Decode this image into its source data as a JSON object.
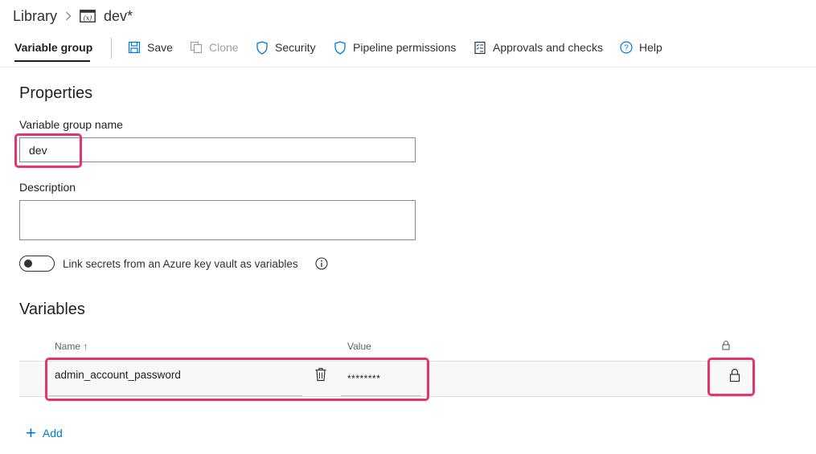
{
  "breadcrumb": {
    "root": "Library",
    "current": "dev*"
  },
  "toolbar": {
    "tab": "Variable group",
    "save": "Save",
    "clone": "Clone",
    "security": "Security",
    "pipeline_permissions": "Pipeline permissions",
    "approvals": "Approvals and checks",
    "help": "Help"
  },
  "properties": {
    "title": "Properties",
    "name_label": "Variable group name",
    "name_value": "dev",
    "description_label": "Description",
    "description_value": "",
    "toggle_label": "Link secrets from an Azure key vault as variables",
    "toggle_on": false
  },
  "variables": {
    "title": "Variables",
    "col_name": "Name ↑",
    "col_value": "Value",
    "rows": [
      {
        "name": "admin_account_password",
        "value": "********",
        "is_secret": true
      }
    ],
    "add_label": "Add"
  },
  "colors": {
    "accent": "#0078d4",
    "highlight": "#e8336d",
    "row_bg": "#f8f8f8"
  }
}
